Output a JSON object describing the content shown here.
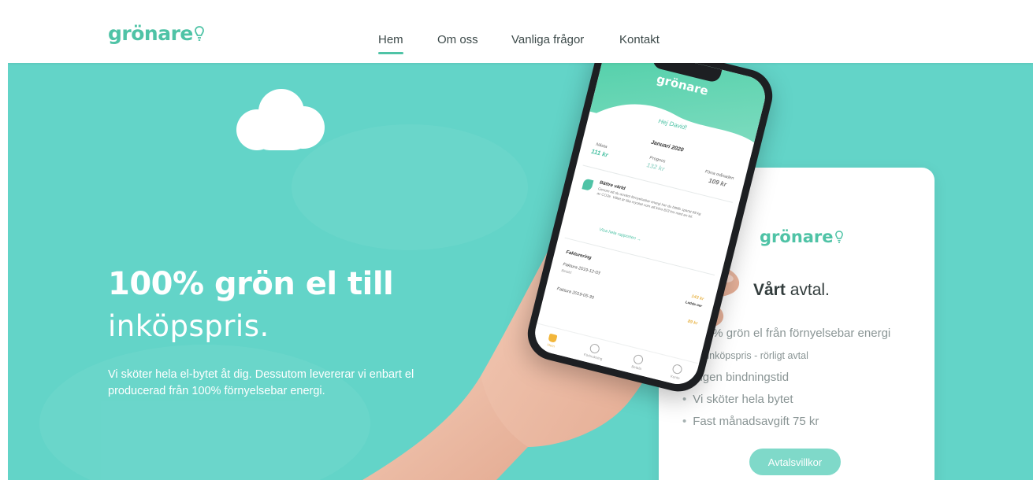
{
  "brand": {
    "name": "grönare",
    "accent": "#4fc3a6",
    "hero_bg": "#63d4c8"
  },
  "nav": {
    "items": [
      {
        "label": "Hem",
        "active": true
      },
      {
        "label": "Om oss",
        "active": false
      },
      {
        "label": "Vanliga frågor",
        "active": false
      },
      {
        "label": "Kontakt",
        "active": false
      }
    ]
  },
  "hero": {
    "title": "100% grön el till",
    "subtitle": "inköpspris.",
    "body": "Vi sköter hela el-bytet åt dig. Dessutom levererar vi enbart el producerad från 100% förnyelsebar energi."
  },
  "agreement_card": {
    "logo": "grönare",
    "title_bold": "Vårt",
    "title_rest": " avtal.",
    "features": [
      "100% grön el från förnyelsebar energi",
      "Till inköpspris - rörligt avtal",
      "Ingen bindningstid",
      "Vi sköter hela bytet",
      "Fast månadsavgift 75 kr"
    ],
    "button_label": "Avtalsvillkor"
  },
  "phone_app": {
    "logo": "grönare",
    "greeting": "Hej David!",
    "month": "Januari 2020",
    "stats": [
      {
        "label": "Nästa",
        "value": "111 kr"
      },
      {
        "label": "Prognos",
        "value": "132 kr"
      },
      {
        "label": "Förra månaden",
        "value": "109 kr"
      }
    ],
    "better_world_title": "Bättre värld",
    "better_world_text": "Genom att du använt förnyelsebar energi har du hittills sparat 88 kg av CO2e. Vilket är lika mycket som att köra 823 km med en bil.",
    "report_link": "Visa hela rapporten",
    "invoices_title": "Fakturering",
    "invoices": [
      {
        "label": "Faktura 2019-12-03",
        "sub": "Betald",
        "amount": "143 kr",
        "status": "Ladda ner"
      },
      {
        "label": "Faktura 2019-05-30",
        "sub": "",
        "amount": "89 kr",
        "status": ""
      }
    ],
    "tabs": [
      "Hem",
      "Förbrukning",
      "Betala",
      "Konto"
    ]
  }
}
